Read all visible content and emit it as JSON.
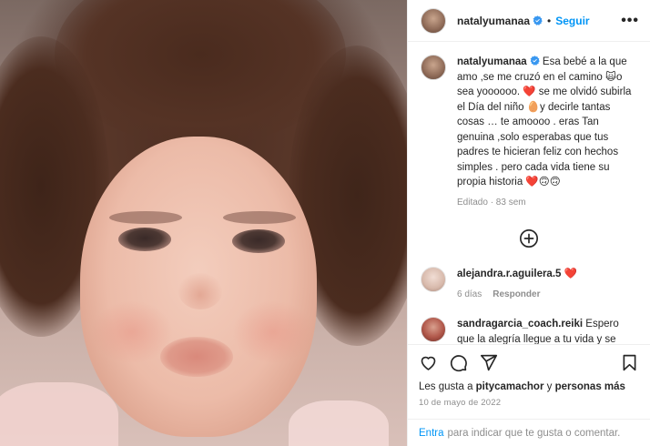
{
  "post": {
    "author": "natalyumanaa",
    "follow_label": "Seguir",
    "separator": "•",
    "more_label": "•••",
    "caption": {
      "author": "natalyumanaa",
      "text": "Esa bebé a la que amo ,se me cruzó en el camino 🙀o sea yoooooo. ❤️ se me olvidó subirla el Día del niño 🥚y decirle tantas cosas … te amoooo . eras Tan genuina ,solo esperabas que tus padres te hicieran feliz con hechos simples . pero cada vida tiene su propia historia ❤️🙃🙃",
      "meta": "Editado · 83 sem"
    },
    "comments": [
      {
        "author": "alejandra.r.aguilera.5",
        "text": "❤️",
        "time": "6 días",
        "reply_label": "Responder"
      },
      {
        "author": "sandragarcia_coach.reiki",
        "text": "Espero que la alegría llegue a tu vida y se quede, tan prestos para juzgarte y nadie sabe lo de"
      }
    ],
    "likes": {
      "prefix": "Les gusta a ",
      "user": "pitycamachor",
      "middle": " y ",
      "others": "personas más"
    },
    "date": "10 de mayo de 2022",
    "add_comment": {
      "link": "Entra",
      "text": "para indicar que te gusta o comentar."
    }
  },
  "icons": {
    "verified": "verified-badge-icon",
    "load_more": "plus-circle-icon",
    "like": "heart-icon",
    "comment": "comment-icon",
    "share": "paper-plane-icon",
    "save": "bookmark-icon"
  },
  "colors": {
    "accent": "#0095f6",
    "verified": "#3897f0",
    "heart": "#e0245e",
    "secondary_text": "#8e8e8e"
  }
}
